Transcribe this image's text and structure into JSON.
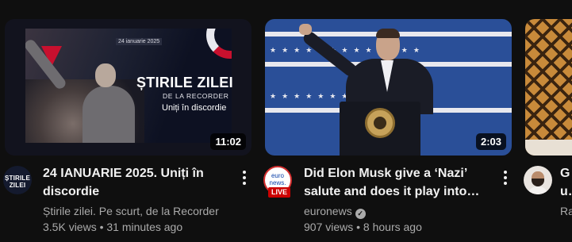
{
  "videos": [
    {
      "title": "24 IANUARIE 2025. Uniți în discordie",
      "channel": "Știrile zilei. Pe scurt, de la Recorder",
      "stats": "3.5K views • 31 minutes ago",
      "duration": "11:02",
      "avatar_text": "ȘTIRILE ZILEI",
      "thumbnail": {
        "date": "24 ianuarie 2025",
        "headline": "ȘTIRILE ZILEI",
        "subhead": "DE LA RECORDER",
        "tagline": "Uniți în discordie"
      }
    },
    {
      "title": "Did Elon Musk give a ‘Nazi’ salute and does it play into the...",
      "channel": "euronews",
      "stats": "907 views • 8 hours ago",
      "duration": "2:03",
      "avatar_text": "euro news.",
      "live_badge": "LIVE",
      "verified_icon": "verified-check-icon"
    },
    {
      "title": "Gu Sh",
      "channel": "Ra",
      "stats": ""
    }
  ],
  "colors": {
    "background": "#0f0f0f",
    "title": "#f1f1f1",
    "meta": "#aaaaaa",
    "live": "#cc0000"
  },
  "icons": {
    "more": "more-vertical-icon"
  }
}
